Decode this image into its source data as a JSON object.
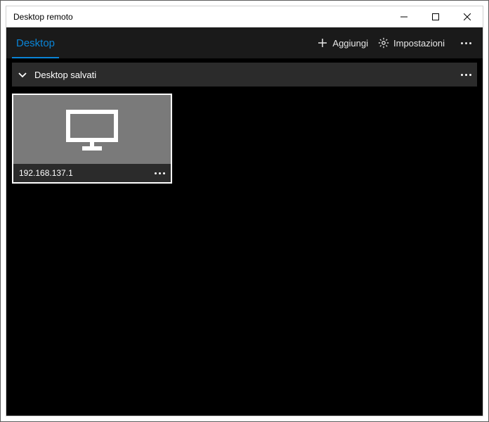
{
  "window": {
    "title": "Desktop remoto"
  },
  "toolbar": {
    "tab_desktop": "Desktop",
    "add_label": "Aggiungi",
    "settings_label": "Impostazioni"
  },
  "group": {
    "title": "Desktop salvati"
  },
  "desktops": [
    {
      "name": "192.168.137.1"
    }
  ]
}
